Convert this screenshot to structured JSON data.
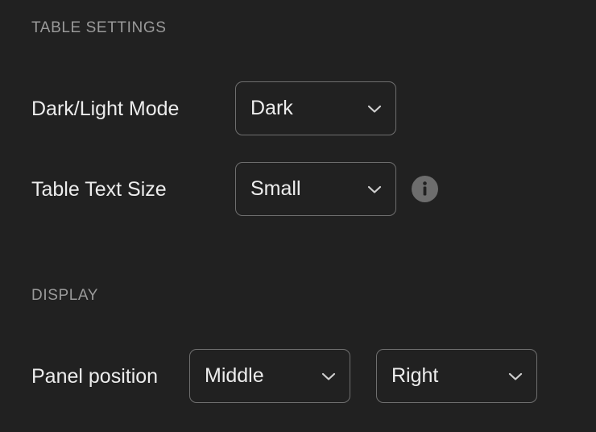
{
  "table_settings": {
    "title": "TABLE SETTINGS",
    "mode": {
      "label": "Dark/Light Mode",
      "value": "Dark",
      "icon": "chevron-down-icon"
    },
    "text_size": {
      "label": "Table Text Size",
      "value": "Small",
      "icon": "chevron-down-icon",
      "info_icon": "info-icon"
    }
  },
  "display": {
    "title": "DISPLAY",
    "panel_position": {
      "label": "Panel position",
      "vertical_value": "Middle",
      "horizontal_value": "Right",
      "icon": "chevron-down-icon"
    }
  },
  "colors": {
    "background": "#212121",
    "section_title": "#9a9a9a",
    "text": "#ececec",
    "border": "#6f6f6f",
    "icon": "#6d6d6d"
  }
}
